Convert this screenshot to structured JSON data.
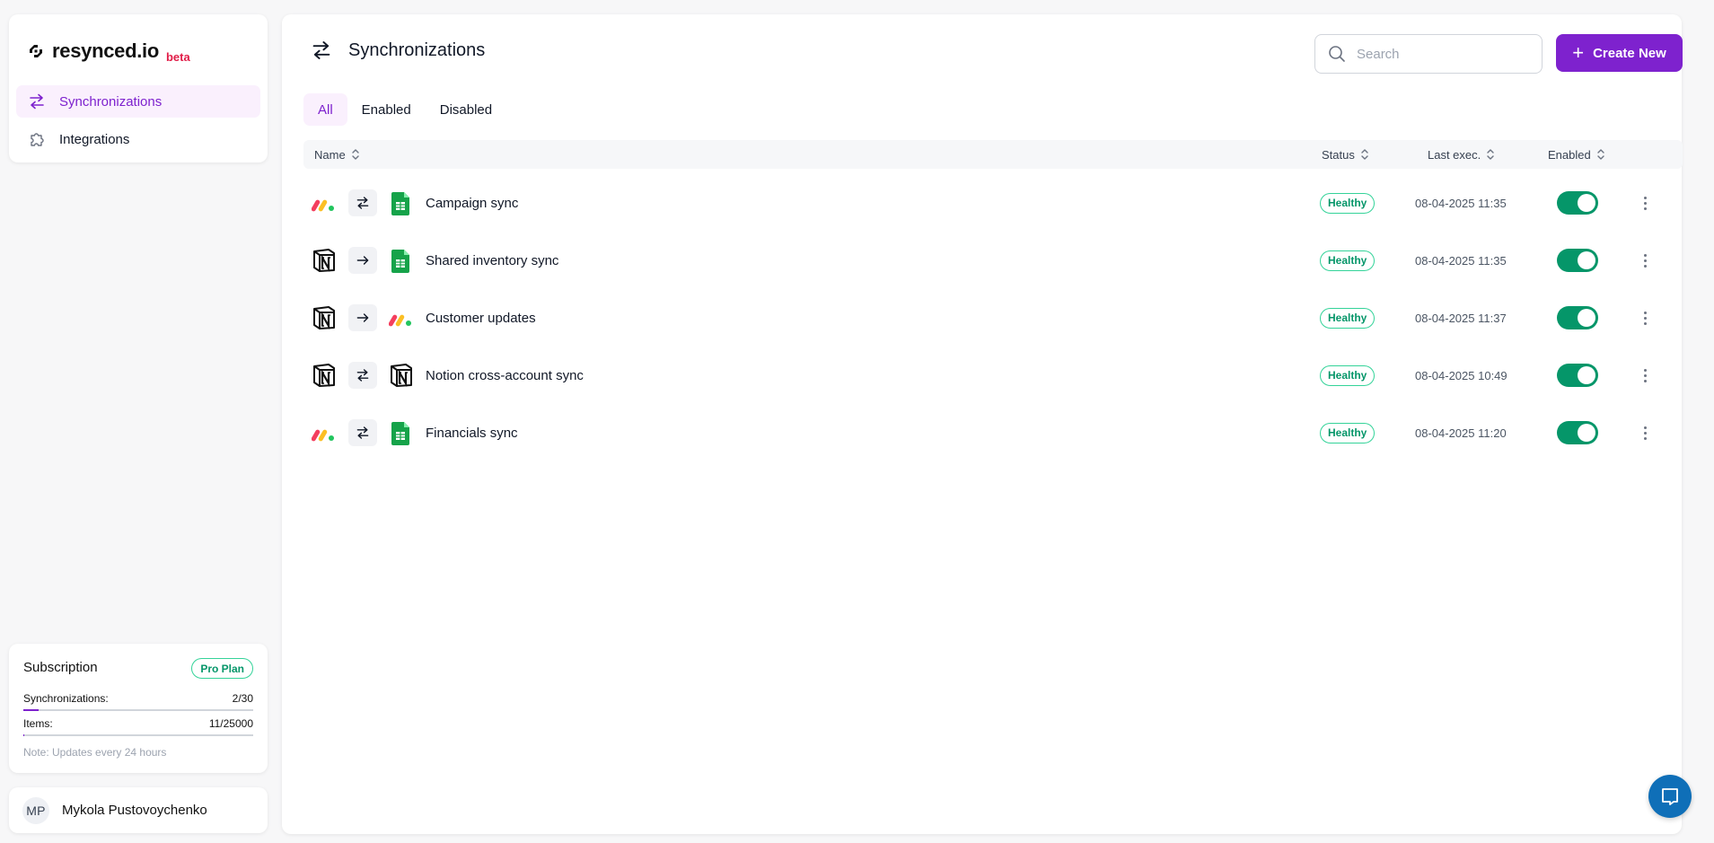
{
  "brand": {
    "name": "resynced.io",
    "tag": "beta",
    "tag_color": "#e11d48",
    "accent": "#7e22ce"
  },
  "sidebar": {
    "items": [
      {
        "label": "Synchronizations",
        "icon": "arrows-exchange-icon",
        "active": true
      },
      {
        "label": "Integrations",
        "icon": "puzzle-icon",
        "active": false
      }
    ]
  },
  "subscription": {
    "title": "Subscription",
    "plan": "Pro Plan",
    "sync_label": "Synchronizations:",
    "sync_value": "2/30",
    "sync_fraction": 0.0667,
    "items_label": "Items:",
    "items_value": "11/25000",
    "items_fraction": 0.00044,
    "note": "Note: Updates every 24 hours"
  },
  "user": {
    "initials": "MP",
    "name": "Mykola Pustovoychenko"
  },
  "header": {
    "title": "Synchronizations",
    "icon": "arrows-exchange-icon"
  },
  "search": {
    "placeholder": "Search",
    "value": ""
  },
  "create_button": {
    "label": "Create New"
  },
  "tabs": [
    {
      "label": "All",
      "active": true
    },
    {
      "label": "Enabled",
      "active": false
    },
    {
      "label": "Disabled",
      "active": false
    }
  ],
  "table": {
    "columns": {
      "name": "Name",
      "status": "Status",
      "last_exec": "Last exec.",
      "enabled": "Enabled"
    },
    "rows": [
      {
        "source": "monday",
        "direction": "two-way",
        "target": "sheets",
        "name": "Campaign sync",
        "status": "Healthy",
        "last_exec": "08-04-2025 11:35",
        "enabled": true
      },
      {
        "source": "notion",
        "direction": "one-way",
        "target": "sheets",
        "name": "Shared inventory sync",
        "status": "Healthy",
        "last_exec": "08-04-2025 11:35",
        "enabled": true
      },
      {
        "source": "notion",
        "direction": "one-way",
        "target": "monday",
        "name": "Customer updates",
        "status": "Healthy",
        "last_exec": "08-04-2025 11:37",
        "enabled": true
      },
      {
        "source": "notion",
        "direction": "two-way",
        "target": "notion",
        "name": "Notion cross-account sync",
        "status": "Healthy",
        "last_exec": "08-04-2025 10:49",
        "enabled": true
      },
      {
        "source": "monday",
        "direction": "two-way",
        "target": "sheets",
        "name": "Financials sync",
        "status": "Healthy",
        "last_exec": "08-04-2025 11:20",
        "enabled": true
      }
    ]
  },
  "status_color": "#059669",
  "chat": {
    "icon": "chat-bubble-icon"
  }
}
